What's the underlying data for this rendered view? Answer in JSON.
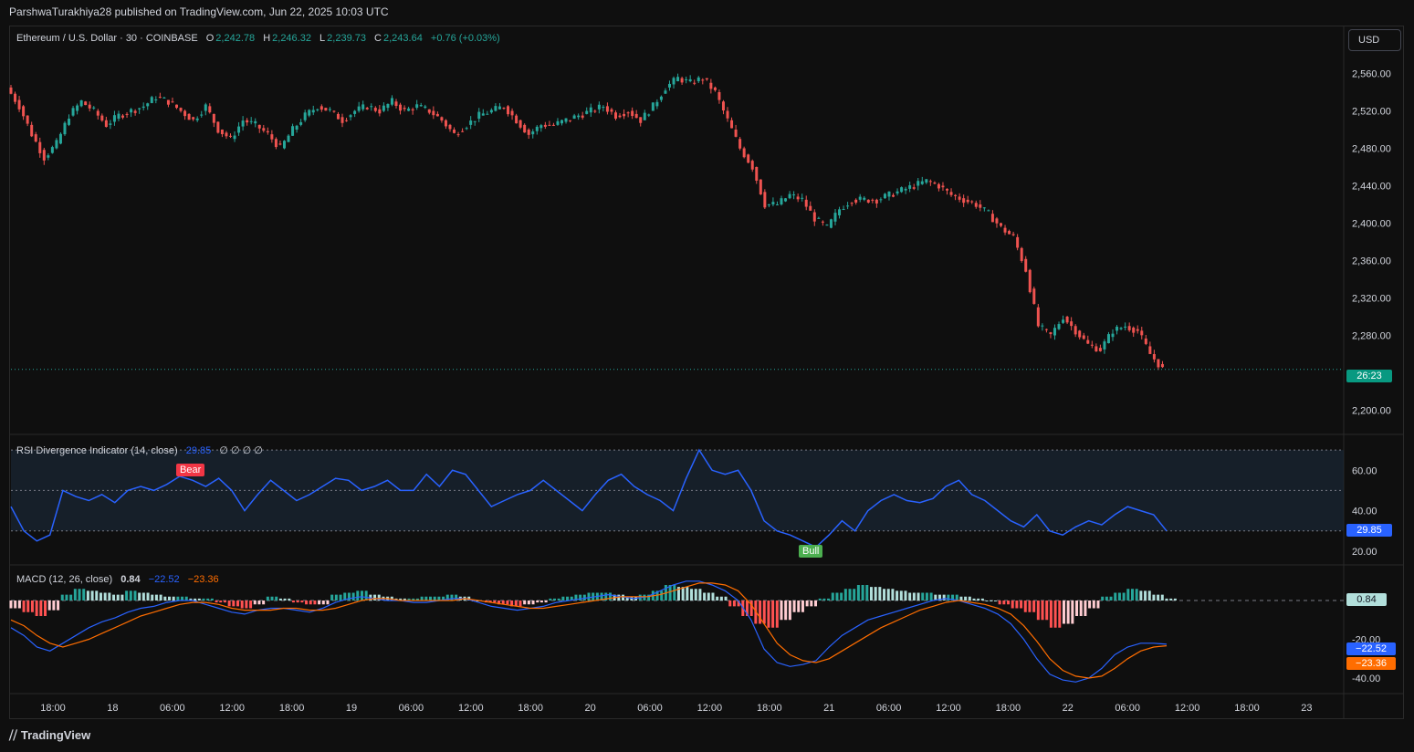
{
  "publisher": "ParshwaTurakhiya28 published on TradingView.com, Jun 22, 2025 10:03 UTC",
  "footer_brand": "TradingView",
  "currency_button": "USD",
  "symbol_legend": {
    "name": "Ethereum / U.S. Dollar · 30 · COINBASE",
    "o_label": "O",
    "o": "2,242.78",
    "h_label": "H",
    "h": "2,246.32",
    "l_label": "L",
    "l": "2,239.73",
    "c_label": "C",
    "c": "2,243.64",
    "change": "+0.76 (+0.03%)"
  },
  "rsi_legend": {
    "name": "RSI Divergence Indicator (14, close)",
    "value": "29.85",
    "extra": "∅ ∅ ∅ ∅"
  },
  "macd_legend": {
    "name": "MACD (12, 26, close)",
    "macd": "0.84",
    "signal_a": "−22.52",
    "signal_b": "−23.36"
  },
  "price_badge": "26:23",
  "rsi_badge": "29.85",
  "macd_badges": {
    "hist": "0.84",
    "macd": "−22.52",
    "signal": "−23.36"
  },
  "signals": {
    "bear": "Bear",
    "bull": "Bull"
  },
  "colors": {
    "up": "#26a69a",
    "down": "#ef5350",
    "rsi": "#2962ff",
    "macd_line": "#2962ff",
    "signal_line": "#ff6d00",
    "hist_up": "#26a69a",
    "hist_down": "#ff5252"
  },
  "chart_data": [
    {
      "type": "candlestick",
      "title": "Ethereum / U.S. Dollar · 30 · COINBASE",
      "ylim": [
        2180,
        2580
      ],
      "yticks": [
        "2,560.00",
        "2,520.00",
        "2,480.00",
        "2,440.00",
        "2,400.00",
        "2,360.00",
        "2,320.00",
        "2,280.00",
        "2,240.00",
        "2,200.00"
      ],
      "ytick_values": [
        2560,
        2520,
        2480,
        2440,
        2400,
        2360,
        2320,
        2280,
        2240,
        2200
      ],
      "xticks": [
        "18:00",
        "18",
        "06:00",
        "12:00",
        "18:00",
        "19",
        "06:00",
        "12:00",
        "18:00",
        "20",
        "06:00",
        "12:00",
        "18:00",
        "21",
        "06:00",
        "12:00",
        "18:00",
        "22",
        "06:00",
        "12:00",
        "18:00",
        "23"
      ],
      "close_path": [
        2545,
        2525,
        2495,
        2470,
        2485,
        2515,
        2530,
        2520,
        2505,
        2515,
        2520,
        2525,
        2535,
        2530,
        2520,
        2510,
        2525,
        2500,
        2490,
        2510,
        2505,
        2495,
        2480,
        2500,
        2515,
        2525,
        2520,
        2510,
        2520,
        2525,
        2520,
        2530,
        2520,
        2525,
        2520,
        2510,
        2495,
        2505,
        2515,
        2520,
        2525,
        2510,
        2495,
        2505,
        2505,
        2510,
        2515,
        2520,
        2525,
        2515,
        2520,
        2510,
        2525,
        2545,
        2555,
        2550,
        2555,
        2540,
        2510,
        2480,
        2460,
        2420,
        2420,
        2430,
        2425,
        2405,
        2395,
        2415,
        2425,
        2425,
        2425,
        2430,
        2435,
        2440,
        2445,
        2440,
        2430,
        2425,
        2420,
        2410,
        2395,
        2385,
        2350,
        2290,
        2280,
        2300,
        2285,
        2270,
        2265,
        2285,
        2290,
        2285,
        2260,
        2244
      ],
      "current_price_line": 2243.64
    },
    {
      "type": "line",
      "title": "RSI Divergence Indicator (14, close)",
      "ylim": [
        15,
        75
      ],
      "band": [
        30,
        70
      ],
      "midline": 50,
      "yticks": [
        "60.00",
        "40.00",
        "20.00"
      ],
      "ytick_values": [
        60,
        40,
        20
      ],
      "values": [
        42,
        30,
        25,
        28,
        50,
        47,
        45,
        48,
        44,
        50,
        52,
        50,
        53,
        57,
        55,
        52,
        56,
        50,
        40,
        48,
        55,
        50,
        45,
        48,
        52,
        56,
        55,
        50,
        52,
        55,
        50,
        50,
        58,
        52,
        60,
        58,
        50,
        42,
        45,
        48,
        50,
        55,
        50,
        45,
        40,
        48,
        55,
        58,
        52,
        48,
        45,
        40,
        56,
        70,
        60,
        58,
        60,
        50,
        35,
        30,
        28,
        25,
        22,
        28,
        35,
        30,
        40,
        45,
        48,
        45,
        44,
        46,
        52,
        55,
        48,
        45,
        40,
        35,
        32,
        38,
        30,
        28,
        32,
        35,
        33,
        38,
        42,
        40,
        38,
        30
      ],
      "bear_label": "Bear",
      "bull_label": "Bull"
    },
    {
      "type": "bar+line",
      "title": "MACD (12, 26, close)",
      "ylim": [
        -48,
        16
      ],
      "yticks": [
        "-20.00",
        "-40.00"
      ],
      "ytick_values": [
        -20,
        -40
      ],
      "histogram": [
        -4,
        -6,
        -8,
        -5,
        3,
        6,
        5,
        4,
        3,
        5,
        4,
        3,
        2,
        2,
        1,
        1,
        -1,
        -3,
        -4,
        -2,
        2,
        1,
        -1,
        -2,
        -2,
        3,
        4,
        5,
        3,
        2,
        1,
        1,
        2,
        2,
        3,
        2,
        0,
        -1,
        -2,
        -3,
        -2,
        -1,
        1,
        2,
        3,
        4,
        4,
        3,
        2,
        3,
        5,
        8,
        7,
        6,
        4,
        2,
        -3,
        -8,
        -12,
        -14,
        -10,
        -6,
        -3,
        1,
        4,
        6,
        8,
        7,
        6,
        5,
        4,
        4,
        3,
        3,
        2,
        1,
        0,
        -2,
        -4,
        -6,
        -10,
        -14,
        -12,
        -8,
        -4,
        2,
        4,
        6,
        5,
        3,
        1
      ],
      "macd_line": [
        -14,
        -18,
        -24,
        -26,
        -22,
        -18,
        -14,
        -11,
        -9,
        -6,
        -4,
        -3,
        -1,
        0,
        0,
        -2,
        -4,
        -6,
        -7,
        -5,
        -4,
        -4,
        -5,
        -6,
        -4,
        -1,
        1,
        2,
        1,
        0,
        0,
        -1,
        -1,
        0,
        1,
        1,
        -1,
        -3,
        -4,
        -5,
        -4,
        -3,
        -1,
        0,
        1,
        2,
        3,
        2,
        1,
        2,
        5,
        8,
        10,
        10,
        8,
        5,
        0,
        -10,
        -25,
        -32,
        -34,
        -33,
        -31,
        -24,
        -18,
        -14,
        -10,
        -8,
        -6,
        -4,
        -2,
        0,
        1,
        0,
        -2,
        -4,
        -7,
        -12,
        -20,
        -30,
        -38,
        -41,
        -42,
        -40,
        -35,
        -28,
        -24,
        -22,
        -22,
        -22.52
      ],
      "signal_line": [
        -10,
        -13,
        -18,
        -22,
        -24,
        -22,
        -20,
        -17,
        -14,
        -11,
        -8,
        -6,
        -4,
        -2,
        -1,
        -1,
        -2,
        -4,
        -5,
        -5,
        -5,
        -4,
        -4,
        -5,
        -5,
        -4,
        -2,
        0,
        1,
        1,
        0,
        0,
        0,
        0,
        0,
        1,
        0,
        -1,
        -2,
        -3,
        -4,
        -4,
        -3,
        -2,
        -1,
        0,
        1,
        2,
        2,
        2,
        3,
        5,
        7,
        9,
        9,
        8,
        5,
        -2,
        -12,
        -22,
        -28,
        -31,
        -32,
        -30,
        -26,
        -22,
        -18,
        -14,
        -11,
        -8,
        -5,
        -3,
        -1,
        0,
        -1,
        -2,
        -4,
        -7,
        -13,
        -21,
        -30,
        -36,
        -39,
        -40,
        -39,
        -35,
        -30,
        -26,
        -24,
        -23.36
      ],
      "zero_line": 0
    }
  ]
}
